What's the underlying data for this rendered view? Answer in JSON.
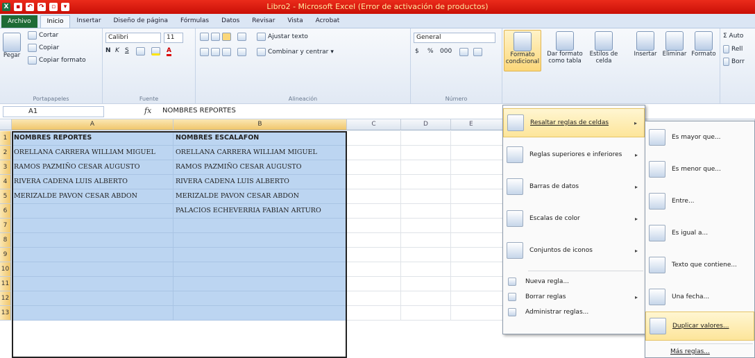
{
  "window": {
    "title": "Libro2 - Microsoft Excel (Error de activación de productos)"
  },
  "ribbon_tabs": [
    "Archivo",
    "Inicio",
    "Insertar",
    "Diseño de página",
    "Fórmulas",
    "Datos",
    "Revisar",
    "Vista",
    "Acrobat"
  ],
  "active_tab": "Inicio",
  "clipboard": {
    "paste": "Pegar",
    "cut": "Cortar",
    "copy": "Copiar",
    "format_painter": "Copiar formato",
    "label": "Portapapeles"
  },
  "font": {
    "name": "Calibri",
    "size": "11",
    "bold": "N",
    "italic": "K",
    "underline": "S",
    "label": "Fuente"
  },
  "alignment": {
    "wrap": "Ajustar texto",
    "merge": "Combinar y centrar",
    "label": "Alineación"
  },
  "number": {
    "format": "General",
    "currency": "$",
    "percent": "%",
    "thousands": "000",
    "label": "Número"
  },
  "styles": {
    "conditional_l1": "Formato",
    "conditional_l2": "condicional",
    "table_l1": "Dar formato",
    "table_l2": "como tabla",
    "cell_l1": "Estilos de",
    "cell_l2": "celda"
  },
  "cells_group": {
    "insert": "Insertar",
    "delete": "Eliminar",
    "format": "Formato"
  },
  "editing": {
    "autosum": "Σ Auto",
    "fill": "Rell",
    "clear": "Borr"
  },
  "formula_bar": {
    "name_box": "A1",
    "fx": "fx",
    "value": "NOMBRES REPORTES"
  },
  "columns": [
    "A",
    "B",
    "C",
    "D",
    "E"
  ],
  "rows": [
    "1",
    "2",
    "3",
    "4",
    "5",
    "6",
    "7",
    "8",
    "9",
    "10",
    "11",
    "12",
    "13"
  ],
  "sheet": {
    "colA": [
      "NOMBRES REPORTES",
      "ORELLANA CARRERA WILLIAM MIGUEL",
      "RAMOS PAZMIÑO CESAR AUGUSTO",
      "RIVERA CADENA LUIS ALBERTO",
      "MERIZALDE PAVON CESAR ABDON",
      "",
      "",
      "",
      "",
      "",
      "",
      "",
      ""
    ],
    "colB": [
      "NOMBRES ESCALAFON",
      "ORELLANA CARRERA WILLIAM MIGUEL",
      "RAMOS PAZMIÑO CESAR AUGUSTO",
      "RIVERA CADENA LUIS ALBERTO",
      "MERIZALDE PAVON CESAR ABDON",
      "PALACIOS ECHEVERRIA FABIAN ARTURO",
      "",
      "",
      "",
      "",
      "",
      "",
      ""
    ]
  },
  "cf_menu": {
    "highlight_rules": "Resaltar reglas de celdas",
    "top_bottom": "Reglas superiores e inferiores",
    "data_bars": "Barras de datos",
    "color_scales": "Escalas de color",
    "icon_sets": "Conjuntos de iconos",
    "new_rule": "Nueva regla...",
    "clear_rules": "Borrar reglas",
    "manage_rules": "Administrar reglas..."
  },
  "highlight_submenu": {
    "greater": "Es mayor que...",
    "less": "Es menor que...",
    "between": "Entre...",
    "equal": "Es igual a...",
    "text_contains": "Texto que contiene...",
    "date": "Una fecha...",
    "duplicates": "Duplicar valores...",
    "more": "Más reglas..."
  }
}
